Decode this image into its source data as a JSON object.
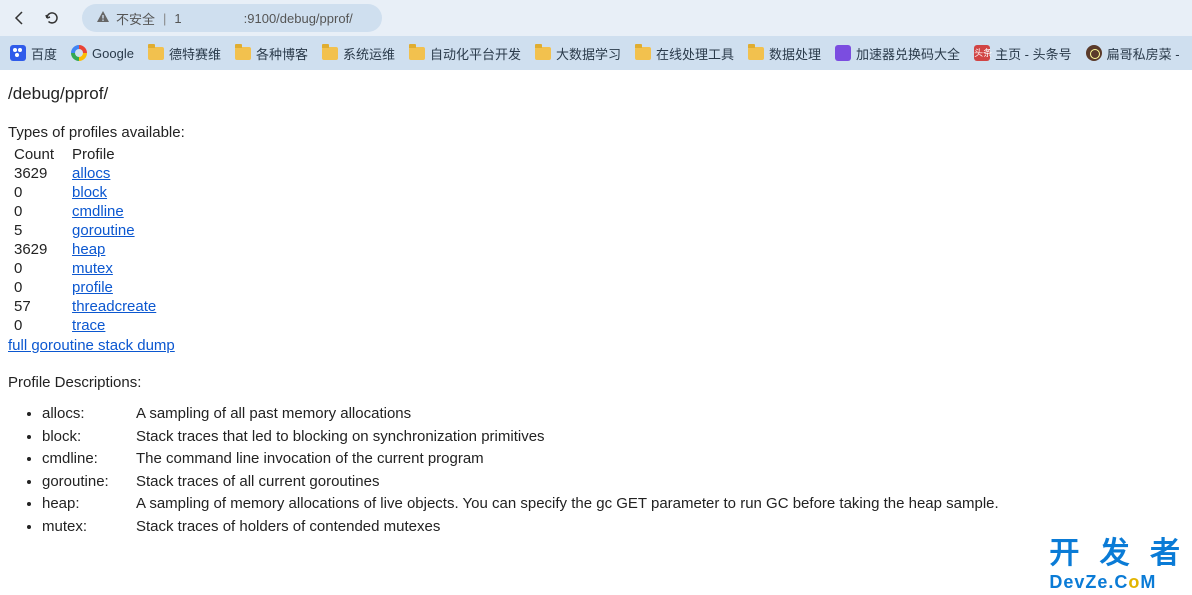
{
  "browser": {
    "url_insecure_label": "不安全",
    "url_prefix": "1",
    "url_rest": ":9100/debug/pprof/"
  },
  "bookmarks": [
    {
      "name": "baidu",
      "label": "百度",
      "icon": "baidu"
    },
    {
      "name": "google",
      "label": "Google",
      "icon": "google"
    },
    {
      "name": "detesai",
      "label": "德特赛维",
      "icon": "folder"
    },
    {
      "name": "blogs",
      "label": "各种博客",
      "icon": "folder"
    },
    {
      "name": "sysops",
      "label": "系统运维",
      "icon": "folder"
    },
    {
      "name": "autoplat",
      "label": "自动化平台开发",
      "icon": "folder"
    },
    {
      "name": "bigdata",
      "label": "大数据学习",
      "icon": "folder"
    },
    {
      "name": "onlinetools",
      "label": "在线处理工具",
      "icon": "folder"
    },
    {
      "name": "dataproc",
      "label": "数据处理",
      "icon": "folder"
    },
    {
      "name": "accel",
      "label": "加速器兑换码大全",
      "icon": "purple"
    },
    {
      "name": "toutiao",
      "label": "主页 - 头条号",
      "icon": "red"
    },
    {
      "name": "bgsf",
      "label": "扁哥私房菜 -",
      "icon": "dark"
    }
  ],
  "page": {
    "title": "/debug/pprof/",
    "types_label": "Types of profiles available:",
    "count_header": "Count",
    "profile_header": "Profile",
    "profiles": [
      {
        "count": "3629",
        "name": "allocs"
      },
      {
        "count": "0",
        "name": "block"
      },
      {
        "count": "0",
        "name": "cmdline"
      },
      {
        "count": "5",
        "name": "goroutine"
      },
      {
        "count": "3629",
        "name": "heap"
      },
      {
        "count": "0",
        "name": "mutex"
      },
      {
        "count": "0",
        "name": "profile"
      },
      {
        "count": "57",
        "name": "threadcreate"
      },
      {
        "count": "0",
        "name": "trace"
      }
    ],
    "full_dump_label": "full goroutine stack dump",
    "desc_title": "Profile Descriptions:",
    "descriptions": [
      {
        "name": "allocs:",
        "text": "A sampling of all past memory allocations"
      },
      {
        "name": "block:",
        "text": "Stack traces that led to blocking on synchronization primitives"
      },
      {
        "name": "cmdline:",
        "text": "The command line invocation of the current program"
      },
      {
        "name": "goroutine:",
        "text": "Stack traces of all current goroutines"
      },
      {
        "name": "heap:",
        "text": "A sampling of memory allocations of live objects. You can specify the gc GET parameter to run GC before taking the heap sample."
      },
      {
        "name": "mutex:",
        "text": "Stack traces of holders of contended mutexes"
      }
    ]
  },
  "watermark": {
    "cn": "开 发 者",
    "en_pre": "DevZe.C",
    "en_o": "o",
    "en_post": "M"
  }
}
